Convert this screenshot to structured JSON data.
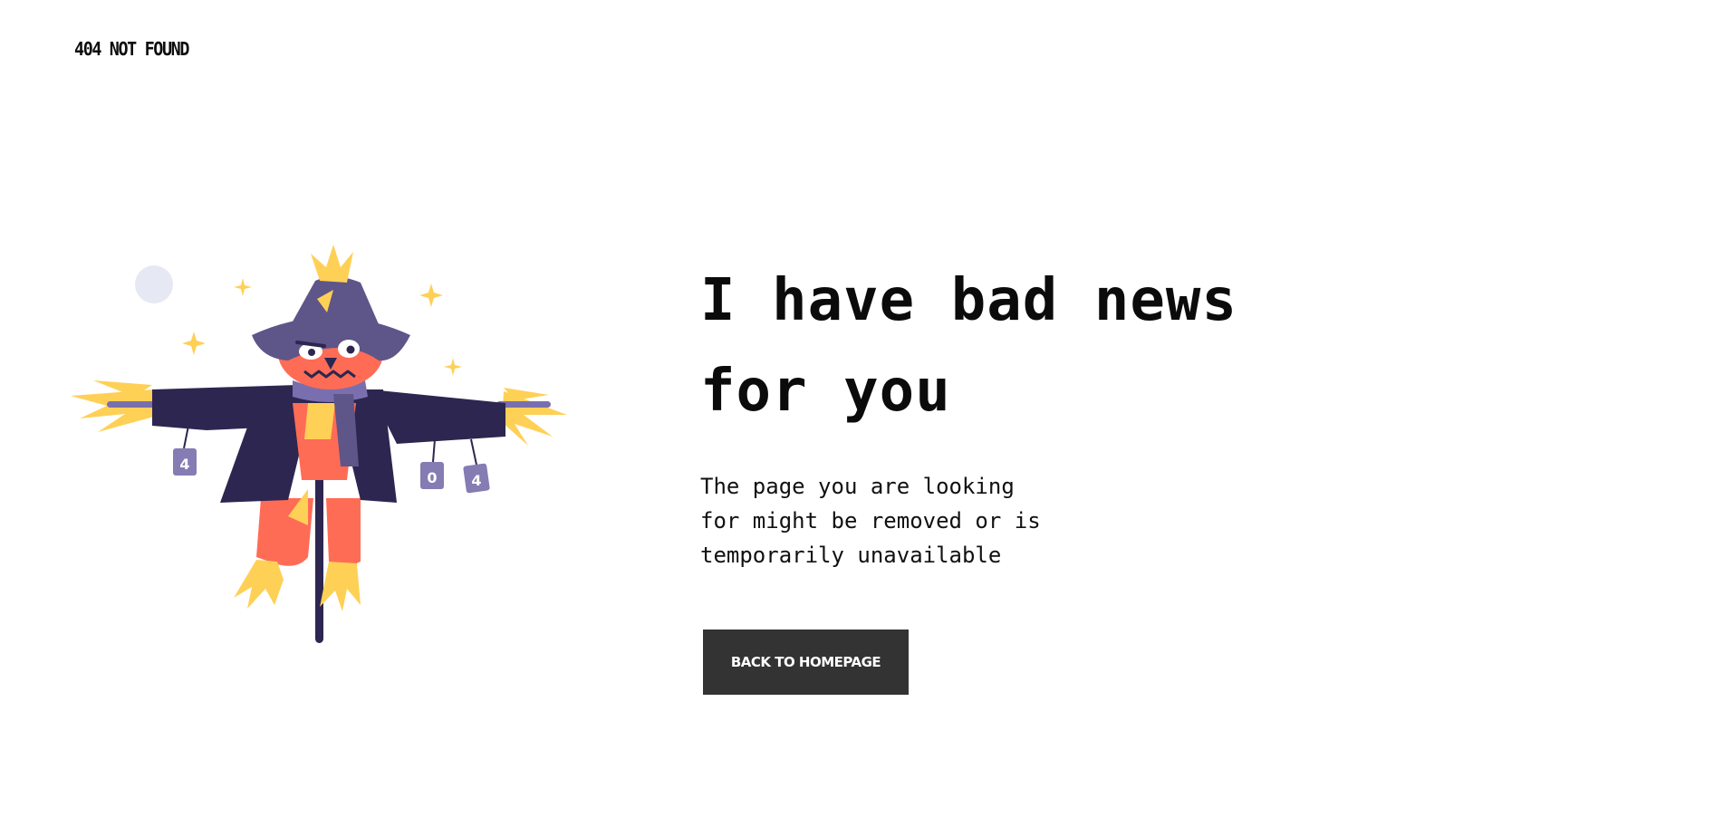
{
  "header": {
    "brand": "404 NOT FOUND"
  },
  "illustration": {
    "name": "scarecrow",
    "can_labels": [
      "4",
      "0",
      "4"
    ],
    "colors": {
      "hat": "#5e5589",
      "coat": "#2d2650",
      "face": "#ff6c56",
      "straw": "#ffd056",
      "scarf": "#7a6fae",
      "can": "#857cb4",
      "moon": "#e6e8f4",
      "sparkle": "#ffd056"
    }
  },
  "main": {
    "headline_lines": [
      "I have bad news",
      "for you"
    ],
    "description_lines": [
      "The page you are looking",
      "for might be removed or is",
      "temporarily unavailable"
    ],
    "cta_label": "BACK TO HOMEPAGE"
  },
  "colors": {
    "background": "#ffffff",
    "text": "#0d0d0d",
    "button": "#333333",
    "button_text": "#ffffff"
  }
}
